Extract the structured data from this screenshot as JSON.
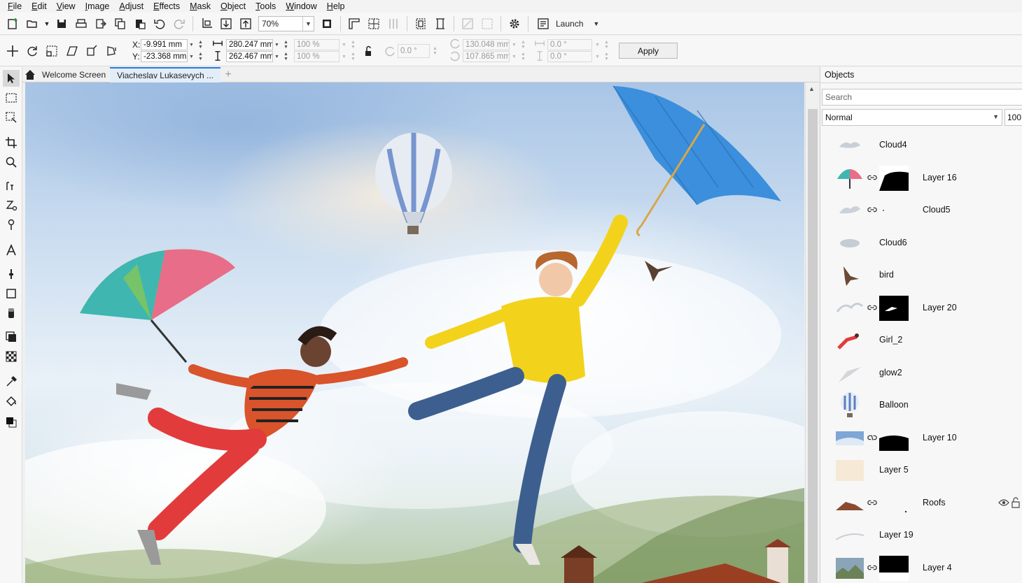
{
  "menu": [
    "File",
    "Edit",
    "View",
    "Image",
    "Adjust",
    "Effects",
    "Mask",
    "Object",
    "Tools",
    "Window",
    "Help"
  ],
  "toolbar": {
    "zoom": "70%",
    "launch_label": "Launch"
  },
  "property_bar": {
    "x_label": "X:",
    "y_label": "Y:",
    "x_value": "-9.991 mm",
    "y_value": "-23.368 mm",
    "width_value": "280.247 mm",
    "height_value": "262.467 mm",
    "scale_x": "100 %",
    "scale_y": "100 %",
    "angle": "0.0 °",
    "center_x": "130.048 mm",
    "center_y": "107.865 mm",
    "skew_h": "0.0 °",
    "skew_v": "0.0 °",
    "apply_label": "Apply"
  },
  "tabs": {
    "welcome": "Welcome Screen",
    "document": "Viacheslav Lukasevych ..."
  },
  "objects_docker": {
    "title": "Objects",
    "search_placeholder": "Search",
    "blend_mode": "Normal",
    "opacity": "100",
    "layers": [
      {
        "name": "Cloud4"
      },
      {
        "name": "Layer 16"
      },
      {
        "name": "Cloud5"
      },
      {
        "name": "Cloud6"
      },
      {
        "name": "bird"
      },
      {
        "name": "Layer 20"
      },
      {
        "name": "Girl_2"
      },
      {
        "name": "glow2"
      },
      {
        "name": "Balloon"
      },
      {
        "name": "Layer 10"
      },
      {
        "name": "Layer 5"
      },
      {
        "name": "Roofs"
      },
      {
        "name": "Layer 19"
      },
      {
        "name": "Layer 4"
      }
    ]
  },
  "colors": {
    "accent": "#2a7bd6",
    "umbrella_blue": "#3b8fdc",
    "sweater_yellow": "#f3d21c",
    "pants_red": "#e23b3b"
  }
}
